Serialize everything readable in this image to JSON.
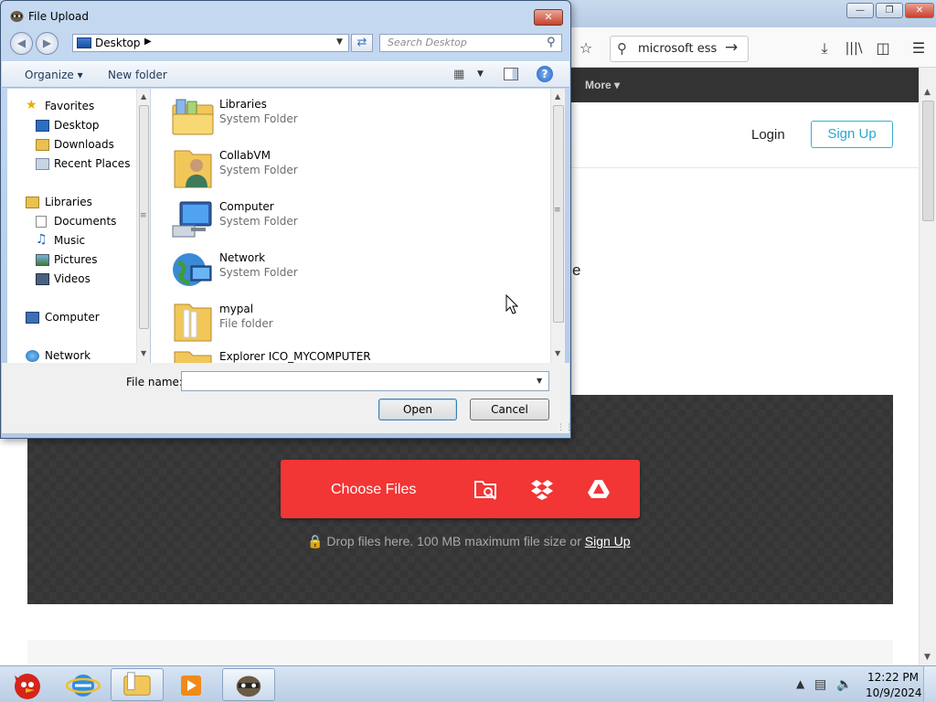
{
  "browser": {
    "search_query": "microsoft ess",
    "nav_more": "More",
    "login": "Login",
    "signup": "Sign Up",
    "partial_char": "e",
    "choose_files": "Choose Files",
    "drop_text": "Drop files here. 100 MB maximum file size or",
    "drop_signup": "Sign Up",
    "accent_color": "#f23535"
  },
  "dialog": {
    "title": "File Upload",
    "address": "Desktop",
    "search_placeholder": "Search Desktop",
    "organize": "Organize",
    "new_folder": "New folder",
    "nav": {
      "favorites": "Favorites",
      "desktop": "Desktop",
      "downloads": "Downloads",
      "recent": "Recent Places",
      "libraries": "Libraries",
      "documents": "Documents",
      "music": "Music",
      "pictures": "Pictures",
      "videos": "Videos",
      "computer": "Computer",
      "network": "Network"
    },
    "files": [
      {
        "name": "Libraries",
        "type": "System Folder",
        "icon": "libraries-icon"
      },
      {
        "name": "CollabVM",
        "type": "System Folder",
        "icon": "user-folder-icon"
      },
      {
        "name": "Computer",
        "type": "System Folder",
        "icon": "computer-icon"
      },
      {
        "name": "Network",
        "type": "System Folder",
        "icon": "network-icon"
      },
      {
        "name": "mypal",
        "type": "File folder",
        "icon": "folder-icon"
      },
      {
        "name": "Explorer ICO_MYCOMPUTER",
        "type": "",
        "icon": "folder-icon"
      }
    ],
    "file_name_label": "File name:",
    "file_name_value": "",
    "open": "Open",
    "cancel": "Cancel"
  },
  "taskbar": {
    "time": "12:22 PM",
    "date": "10/9/2024"
  }
}
